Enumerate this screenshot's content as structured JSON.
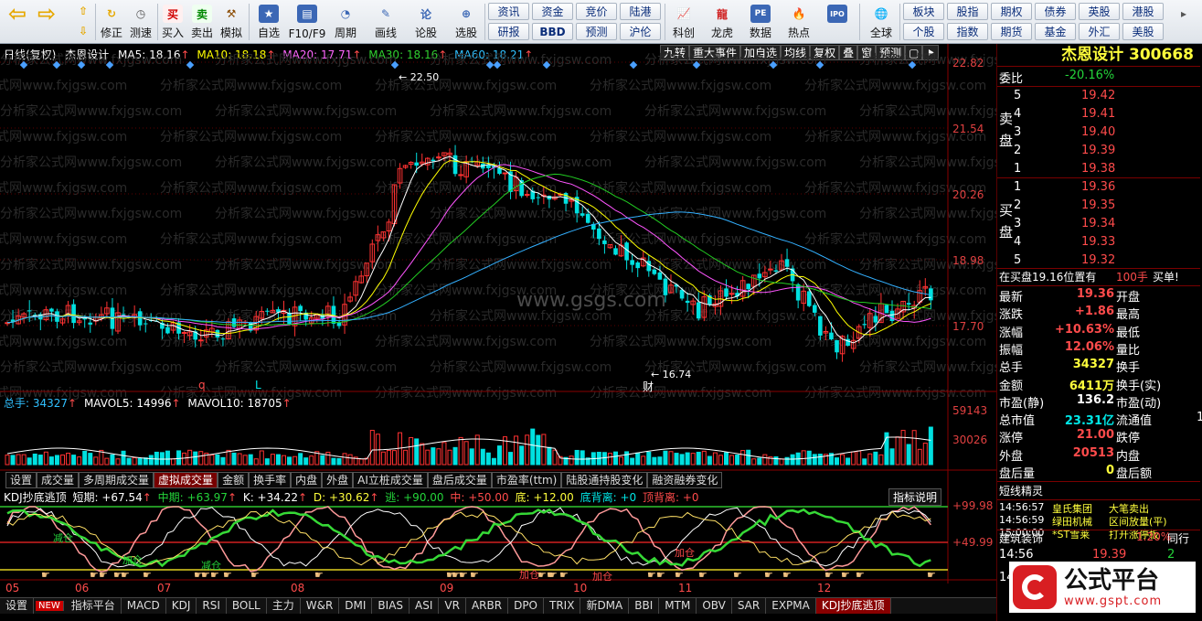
{
  "toolbar": {
    "buttons": [
      {
        "label": "修正",
        "icon": "arrow-up-icon"
      },
      {
        "label": "测速",
        "icon": "clock-icon"
      },
      {
        "label": "买入",
        "icon": "buy-icon",
        "glyph": "买"
      },
      {
        "label": "卖出",
        "icon": "sell-icon",
        "glyph": "卖"
      },
      {
        "label": "模拟",
        "icon": "hammer-icon"
      },
      {
        "label": "自选",
        "icon": "star-icon"
      },
      {
        "label": "F10/F9",
        "icon": "f10-icon"
      },
      {
        "label": "周期",
        "icon": "cycle-icon"
      },
      {
        "label": "画线",
        "icon": "pencil-icon"
      },
      {
        "label": "论股",
        "icon": "discuss-icon",
        "glyph": "论"
      },
      {
        "label": "选股",
        "icon": "select-icon"
      },
      {
        "label": "科创",
        "icon": "tech-icon"
      },
      {
        "label": "龙虎",
        "icon": "dragon-icon"
      },
      {
        "label": "数据",
        "icon": "pe-icon",
        "glyph": "PE"
      },
      {
        "label": "热点",
        "icon": "hot-icon"
      },
      {
        "label": "",
        "icon": "ipo-icon",
        "glyph": "IPO"
      },
      {
        "label": "全球",
        "icon": "globe-icon"
      }
    ],
    "small_buttons": [
      "资讯",
      "资金",
      "竞价",
      "陆港",
      "研报",
      "BBD",
      "预测",
      "沪伦",
      "板块",
      "股指",
      "期权",
      "债券",
      "英股",
      "港股",
      "个股",
      "指数",
      "期货",
      "基金",
      "外汇",
      "美股"
    ]
  },
  "chart": {
    "header": {
      "mode": "日线(复权)",
      "name": "杰恩设计",
      "ma5": "MA5: 18.16",
      "ma10": "MA10: 18.18",
      "ma20": "MA20: 17.71",
      "ma30": "MA30: 18.16",
      "ma60": "MA60: 18.21"
    },
    "top_buttons": [
      "九转",
      "重大事件",
      "加自选",
      "均线",
      "复权",
      "叠",
      "窗",
      "预测",
      "▢",
      "⯈"
    ],
    "price_labels": [
      "22.82",
      "21.54",
      "20.26",
      "18.98",
      "17.70"
    ],
    "high_label": "22.50",
    "low_label": "16.74",
    "markers": [
      "q",
      "L",
      "财"
    ],
    "watermark": "分析家公式网www.fxjgsw.com",
    "center_watermark": "www.gsgs.com",
    "volume_header": {
      "total": "总手: 34327",
      "mavol5": "MAVOL5: 14996",
      "mavol10": "MAVOL10: 18705"
    },
    "volume_labels": [
      "59143",
      "30026"
    ],
    "sub_tabs": [
      "设置",
      "成交量",
      "多周期成交量",
      "虚拟成交量",
      "金额",
      "换手率",
      "内盘",
      "外盘",
      "AI立桩成交量",
      "盘后成交量",
      "市盈率(ttm)",
      "陆股通持股变化",
      "融资融券变化"
    ],
    "active_sub_tab": "虚拟成交量",
    "indicator_help": "指标说明",
    "kdj_header": {
      "name": "KDJ抄底逃顶",
      "short": "短期: +67.54",
      "mid": "中期: +63.97",
      "k": "K: +34.22",
      "d": "D: +30.62",
      "escape": "逃: +90.00",
      "mid2": "中: +50.00",
      "bottom": "底: +12.00",
      "bd": "底背离: +0",
      "td": "顶背离: +0"
    },
    "kdj_labels": [
      "+99.98",
      "+49.99"
    ],
    "kdj_words": [
      "减仓",
      "加仓",
      "减仓",
      "加仓",
      "加仓",
      "加仓"
    ],
    "months": [
      "05",
      "06",
      "07",
      "08",
      "09",
      "10",
      "11",
      "12"
    ],
    "bottom_tabs": [
      "设置",
      "NEW",
      "指标平台",
      "MACD",
      "KDJ",
      "RSI",
      "BOLL",
      "主力",
      "W&R",
      "DMI",
      "BIAS",
      "ASI",
      "VR",
      "ARBR",
      "DPO",
      "TRIX",
      "新DMA",
      "BBI",
      "MTM",
      "OBV",
      "SAR",
      "EXPMA",
      "KDJ抄底逃顶"
    ],
    "active_bottom_tab": "KDJ抄底逃顶"
  },
  "quote": {
    "title": "杰恩设计 300668",
    "wb_label": "委比",
    "wb": "-20.16%",
    "sell_side": "卖盘",
    "buy_side": "买盘",
    "asks": [
      {
        "lvl": "5",
        "p": "19.42"
      },
      {
        "lvl": "4",
        "p": "19.41"
      },
      {
        "lvl": "3",
        "p": "19.40"
      },
      {
        "lvl": "2",
        "p": "19.39"
      },
      {
        "lvl": "1",
        "p": "19.38"
      }
    ],
    "bids": [
      {
        "lvl": "1",
        "p": "19.36"
      },
      {
        "lvl": "2",
        "p": "19.35"
      },
      {
        "lvl": "3",
        "p": "19.34"
      },
      {
        "lvl": "4",
        "p": "19.33"
      },
      {
        "lvl": "5",
        "p": "19.32"
      }
    ],
    "bid_notice": "在买盘19.16位置有",
    "bid_notice_qty": "100手",
    "bid_notice_tag": "买单!",
    "stats": [
      {
        "l": "最新",
        "v": "19.36",
        "c": "red",
        "l2": "开盘",
        "v2": ""
      },
      {
        "l": "涨跌",
        "v": "+1.86",
        "c": "red",
        "l2": "最高",
        "v2": ""
      },
      {
        "l": "涨幅",
        "v": "+10.63%",
        "c": "red",
        "l2": "最低",
        "v2": ""
      },
      {
        "l": "振幅",
        "v": "12.06%",
        "c": "red",
        "l2": "量比",
        "v2": ""
      },
      {
        "l": "总手",
        "v": "34327",
        "c": "yel",
        "l2": "换手",
        "v2": ""
      },
      {
        "l": "金额",
        "v": "6411万",
        "c": "yel",
        "l2": "换手(实)",
        "v2": ""
      },
      {
        "l": "市盈(静)",
        "v": "136.2",
        "c": "wht",
        "l2": "市盈(动)",
        "v2": ""
      },
      {
        "l": "总市值",
        "v": "23.31亿",
        "c": "cyn",
        "l2": "流通值",
        "v2": "1"
      },
      {
        "l": "涨停",
        "v": "21.00",
        "c": "red",
        "l2": "跌停",
        "v2": ""
      },
      {
        "l": "外盘",
        "v": "20513",
        "c": "red",
        "l2": "内盘",
        "v2": ""
      },
      {
        "l": "盘后量",
        "v": "0",
        "c": "yel",
        "l2": "盘后额",
        "v2": ""
      }
    ],
    "spirit_title": "短线精灵",
    "spirit": [
      {
        "t": "14:56:57",
        "n": "皇氏集团",
        "e": "大笔卖出"
      },
      {
        "t": "14:56:59",
        "n": "绿田机械",
        "e": "区间放量(平)"
      },
      {
        "t": "15:00:00",
        "n": "*ST雪莱",
        "e": "打开涨停板"
      }
    ],
    "sector": "建筑装饰",
    "sector_chg": "1.20%",
    "sector_tab": "同行",
    "tick": {
      "time": "14:56",
      "price": "19.39",
      "vol": "2"
    },
    "tick2_time": "14"
  },
  "brand": {
    "name": "公式平台",
    "url": "www.gspt.com"
  }
}
